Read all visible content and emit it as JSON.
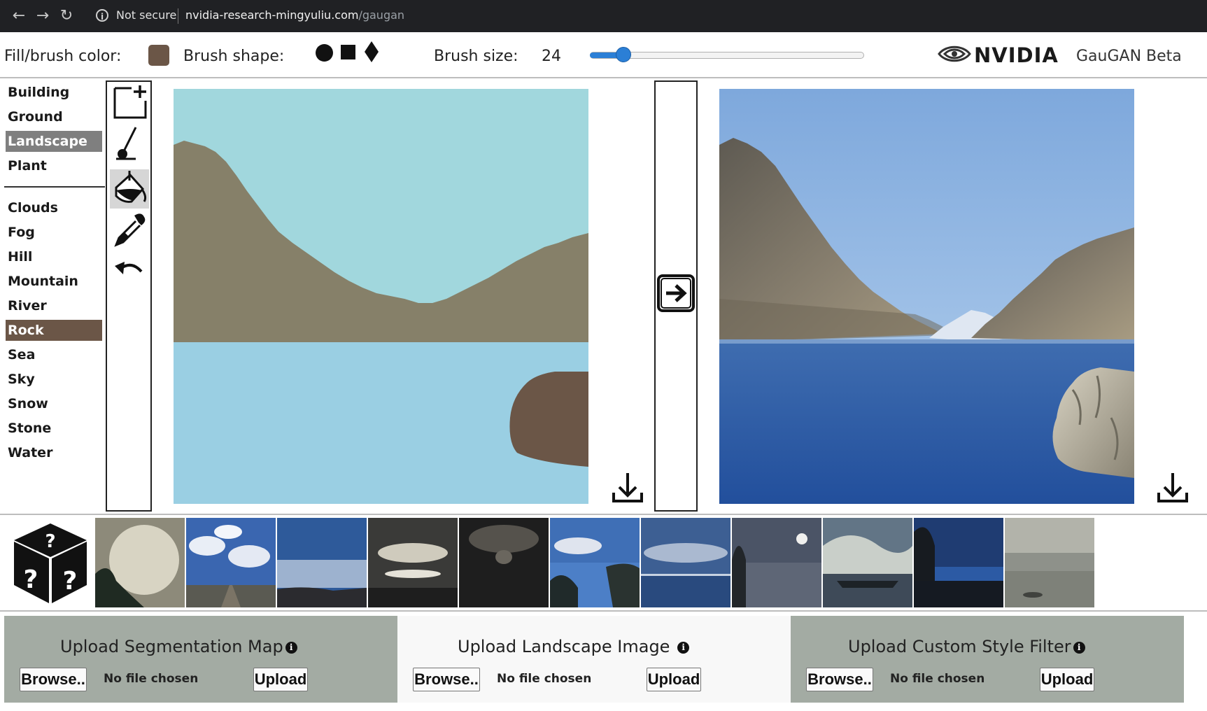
{
  "browser": {
    "secure_label": "Not secure",
    "domain": "nvidia-research-mingyuliu.com",
    "path": "/gaugan"
  },
  "toolbar": {
    "fill_label": "Fill/brush color:",
    "fill_color": "#6b5647",
    "brush_shape_label": "Brush shape:",
    "brush_shapes": [
      "circle",
      "square",
      "diamond"
    ],
    "brush_size_label": "Brush size:",
    "brush_size": "24",
    "brush_size_fraction": 0.12,
    "brand": "NVIDIA",
    "app_name": "GauGAN Beta"
  },
  "labels": {
    "group_one": [
      "Building",
      "Ground",
      "Landscape",
      "Plant"
    ],
    "group_two": [
      "Clouds",
      "Fog",
      "Hill",
      "Mountain",
      "River",
      "Rock",
      "Sea",
      "Sky",
      "Snow",
      "Stone",
      "Water"
    ],
    "selected_group": "Landscape",
    "selected_label": "Rock"
  },
  "tools": [
    "new-canvas-icon",
    "brush-icon",
    "paint-bucket-icon",
    "eyedropper-icon",
    "undo-icon"
  ],
  "colors": {
    "sky": "#a1d7dd",
    "mountain": "#868069",
    "sea": "#9acfe3",
    "rock": "#6b5647",
    "selected_gray": "#7f7f7f",
    "panel_gray": "#a3aba3",
    "panel_light": "#f8f8f8"
  },
  "uploads": [
    {
      "title": "Upload Segmentation Map",
      "browse": "Browse..",
      "status": "No file chosen",
      "upload": "Upload"
    },
    {
      "title": "Upload Landscape Image",
      "browse": "Browse..",
      "status": "No file chosen",
      "upload": "Upload"
    },
    {
      "title": "Upload Custom Style Filter",
      "browse": "Browse..",
      "status": "No file chosen",
      "upload": "Upload"
    }
  ],
  "style_thumbnails_count": 11
}
